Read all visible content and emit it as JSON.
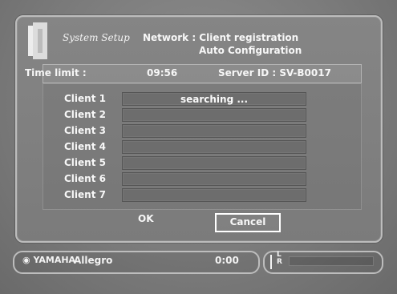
{
  "header": {
    "brand_icon": "door-icon",
    "title": "System Setup",
    "network": "Network : Client registration",
    "subtitle": "Auto Configuration"
  },
  "info": {
    "time_limit_label": "Time limit :",
    "time_limit_value": "09:56",
    "server_id_label": "Server ID : SV-B0017"
  },
  "clients": [
    {
      "label": "Client 1",
      "status": "searching ..."
    },
    {
      "label": "Client 2",
      "status": ""
    },
    {
      "label": "Client 3",
      "status": ""
    },
    {
      "label": "Client 4",
      "status": ""
    },
    {
      "label": "Client 5",
      "status": ""
    },
    {
      "label": "Client 6",
      "status": ""
    },
    {
      "label": "Client 7",
      "status": ""
    }
  ],
  "buttons": {
    "ok_label": "OK",
    "cancel_label": "Cancel"
  },
  "status_bar": {
    "logo": "YAMAHA",
    "track": "Allegro",
    "time": "0:00",
    "lr_label": "L\nR",
    "level_l": 0,
    "level_r": 0
  },
  "colors": {
    "background": "#7d7d7d",
    "panel": "#808080",
    "text": "#f2f2f2"
  }
}
